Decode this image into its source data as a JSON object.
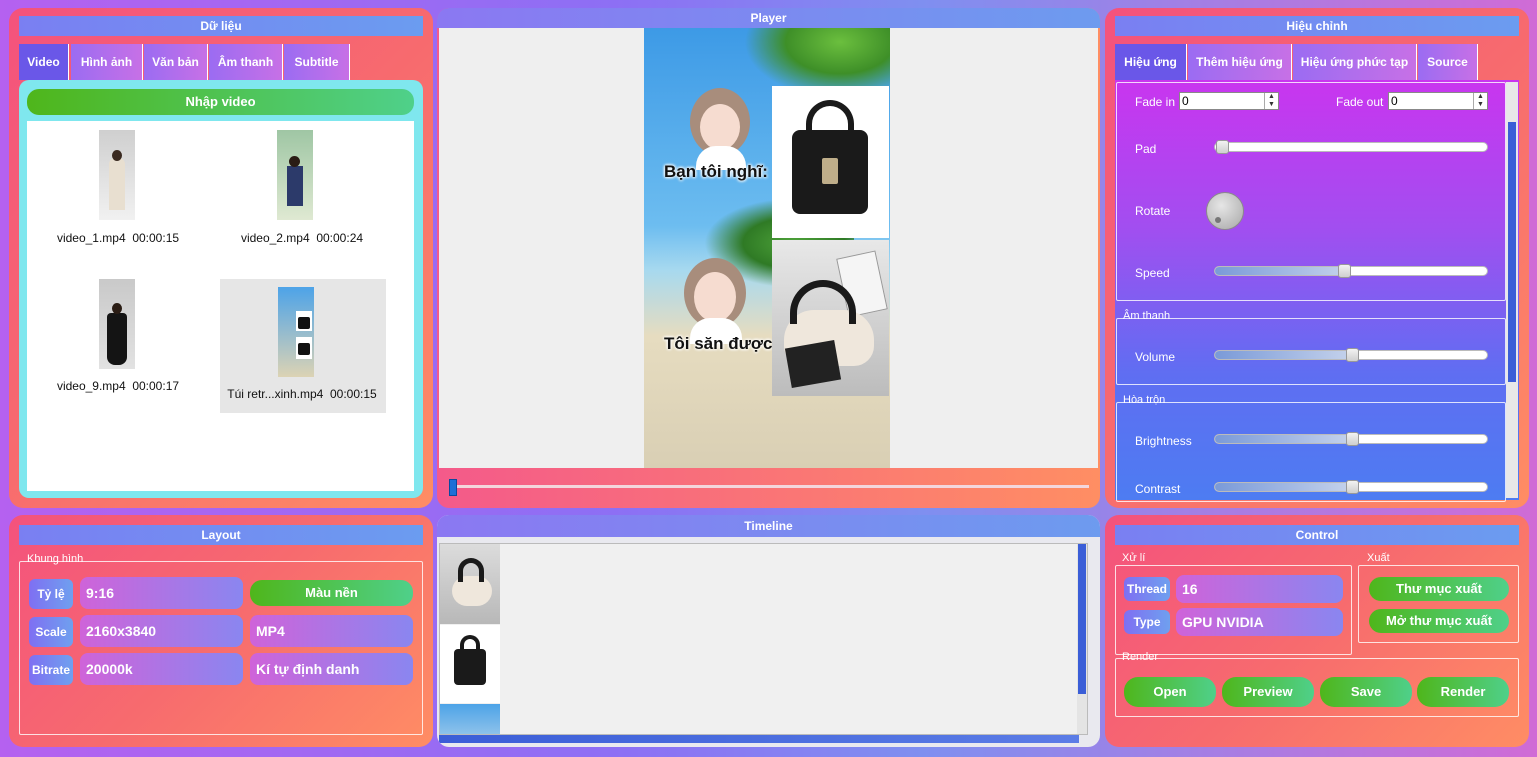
{
  "data_panel": {
    "title": "Dữ liệu",
    "tabs": [
      "Video",
      "Hình ảnh",
      "Văn bản",
      "Âm thanh",
      "Subtitle"
    ],
    "import_button": "Nhập video",
    "videos": [
      {
        "name": "video_1.mp4",
        "duration": "00:00:15"
      },
      {
        "name": "video_2.mp4",
        "duration": "00:00:24"
      },
      {
        "name": "video_9.mp4",
        "duration": "00:00:17"
      },
      {
        "name": "Túi retr...xinh.mp4",
        "duration": "00:00:15"
      }
    ]
  },
  "player": {
    "title": "Player",
    "caption_top": "Bạn tôi nghĩ:",
    "caption_bottom": "Tôi săn được:",
    "progress": 0.0
  },
  "adjust_panel": {
    "title": "Hiệu chỉnh",
    "tabs": [
      "Hiệu ứng",
      "Thêm hiệu ứng",
      "Hiệu ứng phức tạp",
      "Source"
    ],
    "fade_in_label": "Fade in",
    "fade_in_value": "0",
    "fade_out_label": "Fade out",
    "fade_out_value": "0",
    "pad_label": "Pad",
    "pad_value": 0.0,
    "rotate_label": "Rotate",
    "speed_label": "Speed",
    "speed_value": 0.5,
    "audio_group": "Âm thanh",
    "volume_label": "Volume",
    "volume_value": 0.5,
    "mix_group": "Hòa trộn",
    "brightness_label": "Brightness",
    "brightness_value": 0.5,
    "contrast_label": "Contrast",
    "contrast_value": 0.5
  },
  "layout_panel": {
    "title": "Layout",
    "frame_group": "Khung hình",
    "ratio_label": "Tỷ lệ",
    "ratio_value": "9:16",
    "bg_color_button": "Màu nền",
    "scale_label": "Scale",
    "scale_value": "2160x3840",
    "format_value": "MP4",
    "bitrate_label": "Bitrate",
    "bitrate_value": "20000k",
    "identifier_value": "Kí tự định danh"
  },
  "timeline": {
    "title": "Timeline"
  },
  "control_panel": {
    "title": "Control",
    "process_group": "Xử lí",
    "thread_label": "Thread",
    "thread_value": "16",
    "type_label": "Type",
    "type_value": "GPU NVIDIA",
    "export_group": "Xuất",
    "output_folder_button": "Thư mục xuất",
    "open_folder_button": "Mở thư mục xuất",
    "render_group": "Render",
    "open_button": "Open",
    "preview_button": "Preview",
    "save_button": "Save",
    "render_button": "Render"
  }
}
